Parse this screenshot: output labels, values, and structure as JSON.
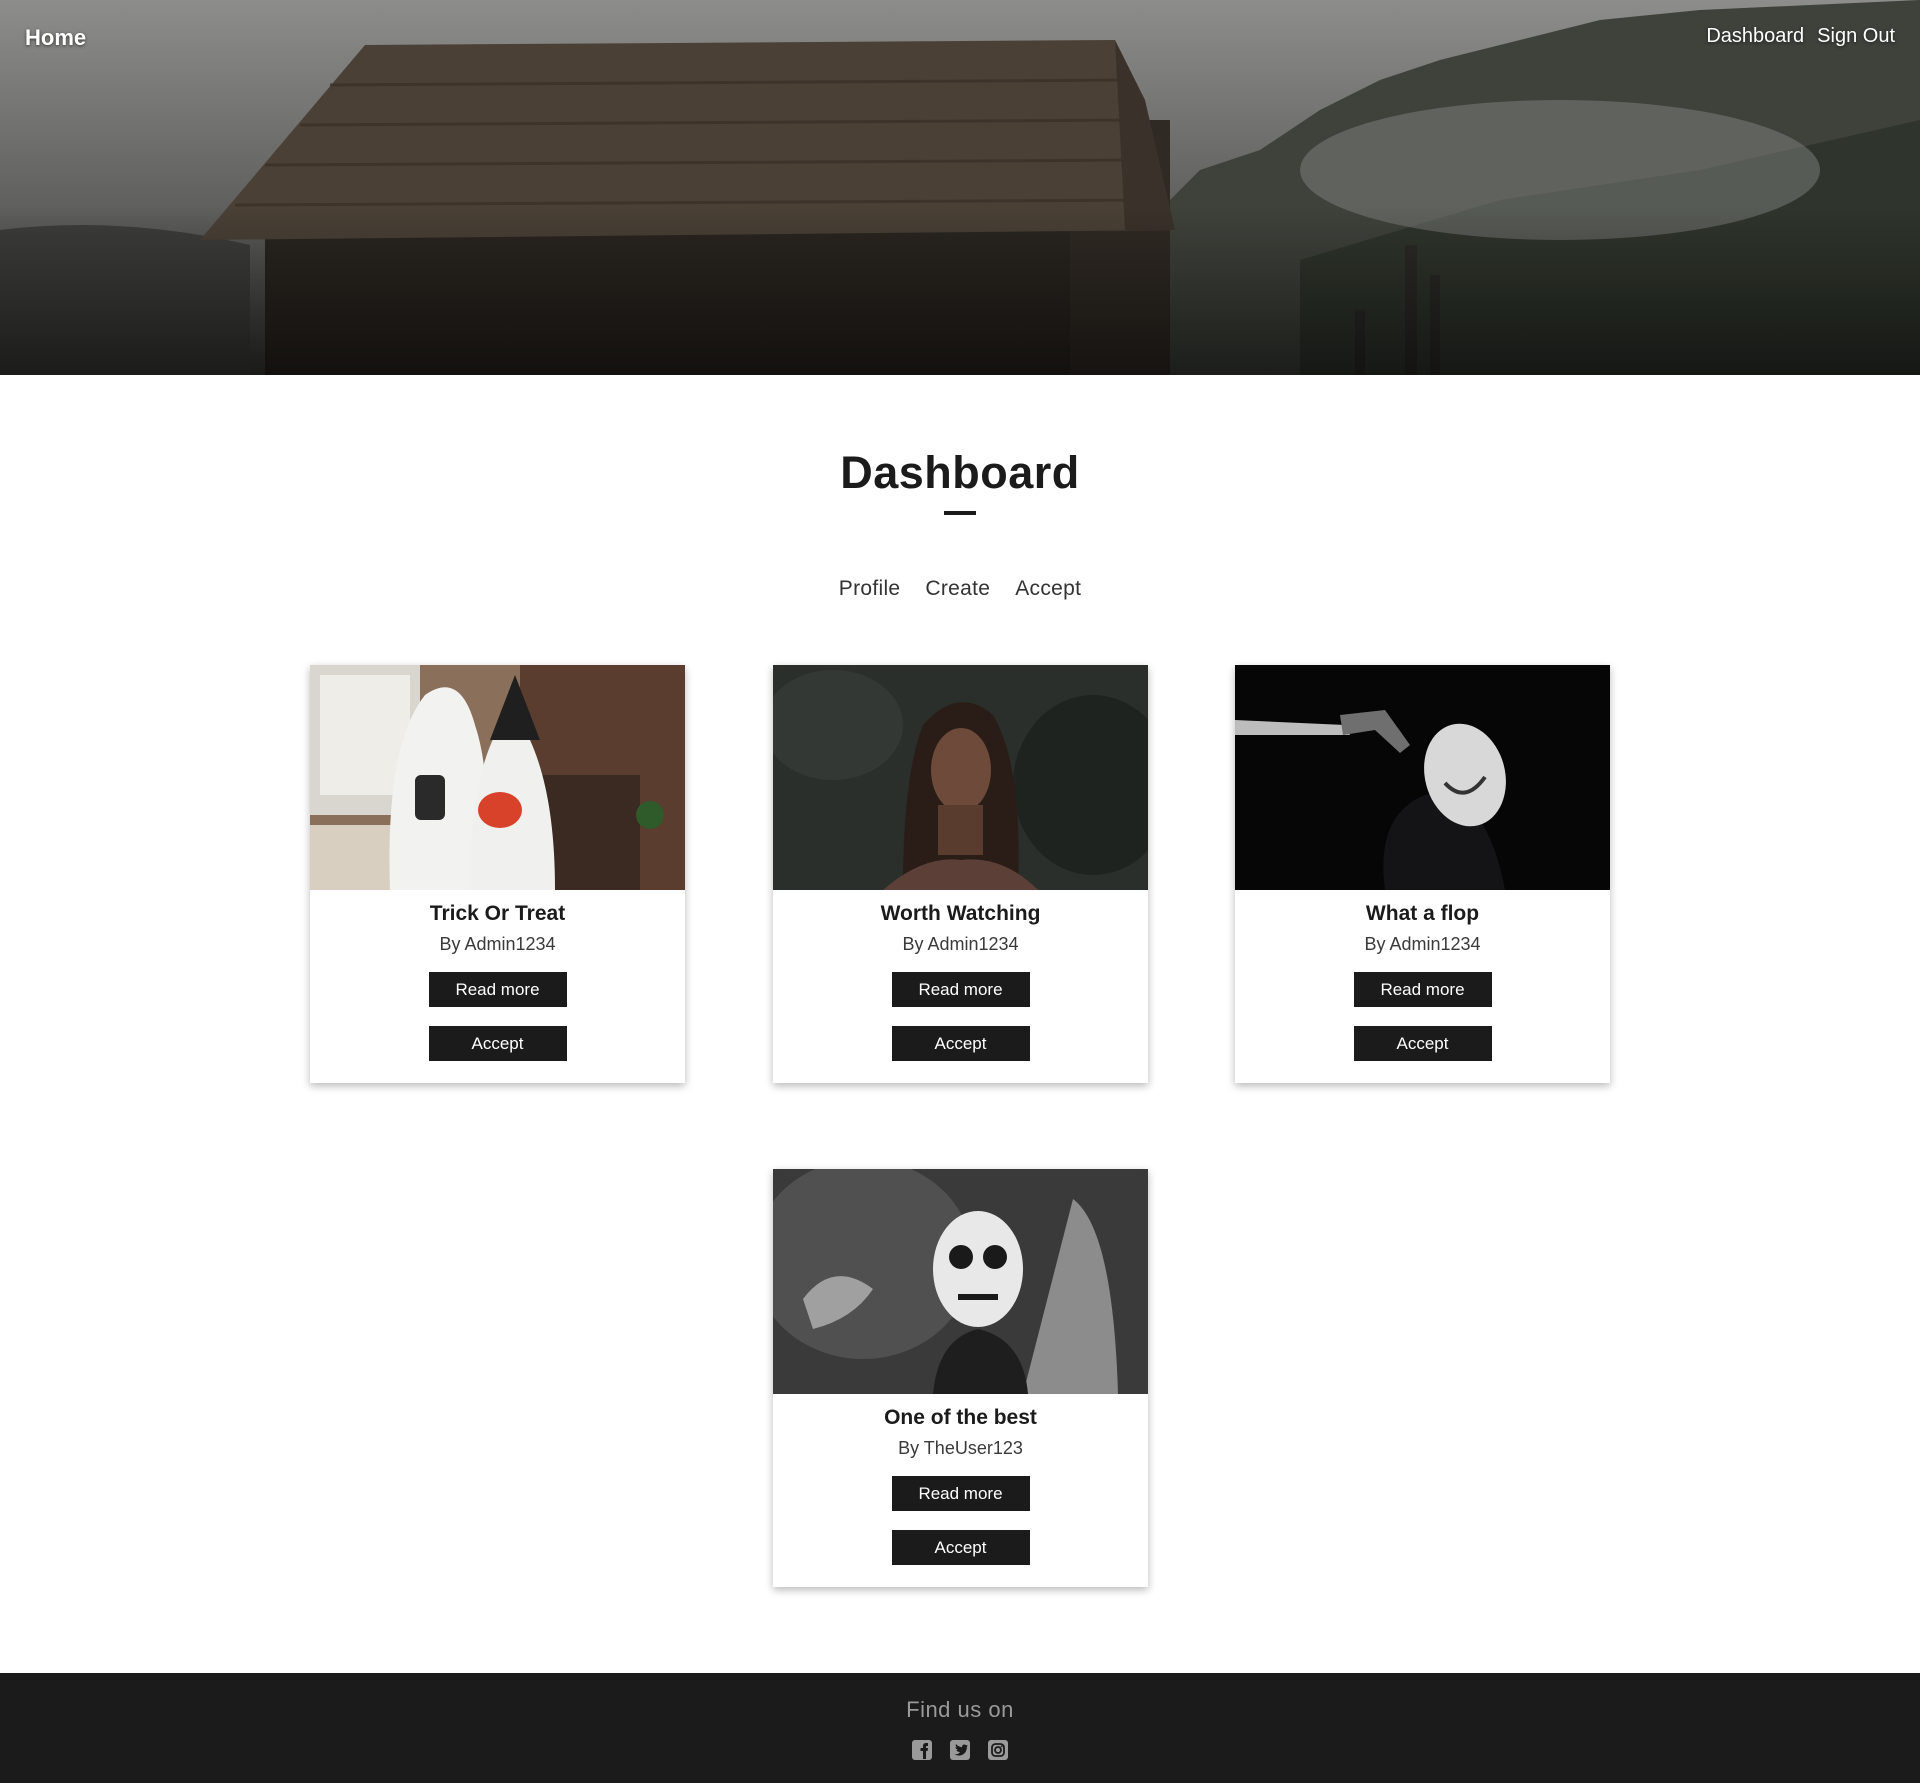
{
  "nav": {
    "home": "Home",
    "links": [
      "Dashboard",
      "Sign Out"
    ]
  },
  "page": {
    "title": "Dashboard"
  },
  "subnav": [
    "Profile",
    "Create",
    "Accept"
  ],
  "cards": [
    {
      "title": "Trick Or Treat",
      "author": "By Admin1234",
      "read_label": "Read more",
      "accept_label": "Accept"
    },
    {
      "title": "Worth Watching",
      "author": "By Admin1234",
      "read_label": "Read more",
      "accept_label": "Accept"
    },
    {
      "title": "What a flop",
      "author": "By Admin1234",
      "read_label": "Read more",
      "accept_label": "Accept"
    },
    {
      "title": "One of the best",
      "author": "By TheUser123",
      "read_label": "Read more",
      "accept_label": "Accept"
    }
  ],
  "footer": {
    "text": "Find us on",
    "icons": [
      "facebook-icon",
      "twitter-icon",
      "instagram-icon"
    ]
  },
  "colors": {
    "dark": "#1b1b1b",
    "footer_text": "#9a9a9a",
    "white": "#ffffff"
  }
}
